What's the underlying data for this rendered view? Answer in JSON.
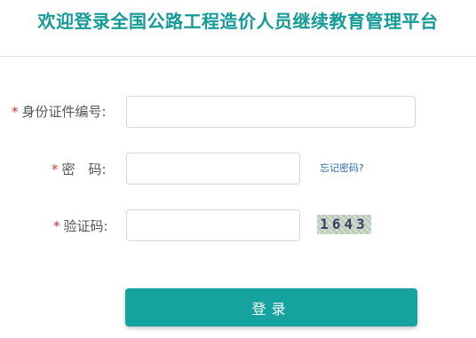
{
  "header": {
    "title": "欢迎登录全国公路工程造价人员继续教育管理平台"
  },
  "form": {
    "required_mark": "*",
    "id_number": {
      "label": "身份证件编号:",
      "value": "",
      "placeholder": ""
    },
    "password": {
      "label": "密　码:",
      "value": "",
      "placeholder": "",
      "forgot_link": "忘记密码?"
    },
    "captcha": {
      "label": "验证码:",
      "value": "",
      "placeholder": "",
      "image_text": "1643"
    },
    "submit_label": "登录"
  },
  "colors": {
    "brand": "#149b97",
    "button": "#16a29e",
    "required": "#d9352f",
    "link": "#2a6fb8"
  }
}
